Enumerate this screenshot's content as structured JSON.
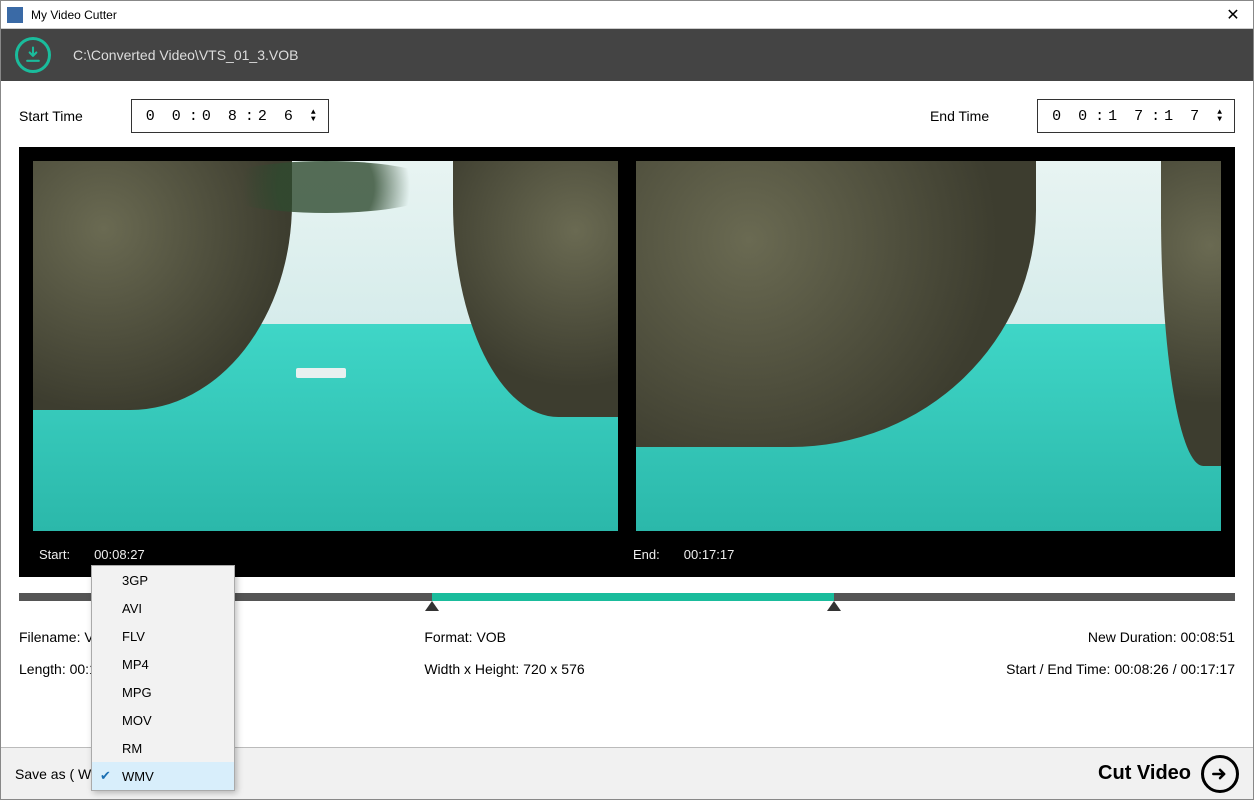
{
  "window": {
    "title": "My Video Cutter"
  },
  "header": {
    "file_path": "C:\\Converted Video\\VTS_01_3.VOB"
  },
  "time": {
    "start_label": "Start Time",
    "end_label": "End Time",
    "start_hh": "0 0",
    "start_mm": "0 8",
    "start_ss": "2 6",
    "end_hh": "0 0",
    "end_mm": "1 7",
    "end_ss": "1 7"
  },
  "preview": {
    "start_label": "Start:",
    "start_value": "00:08:27",
    "end_label": "End:",
    "end_value": "00:17:17"
  },
  "timeline": {
    "sel_start_pct": 34,
    "sel_end_pct": 67
  },
  "info": {
    "filename_label": "Filename:",
    "filename_value": "VTS_01_3.VOB",
    "format_label": "Format:",
    "format_value": "VOB",
    "newdur_label": "New Duration:",
    "newdur_value": "00:08:51",
    "length_label": "Length:",
    "length_value": "00:17:17",
    "dims_label": "Width x Height:",
    "dims_value": "720 x 576",
    "startend_label": "Start / End Time:",
    "startend_value": "00:08:26 / 00:17:17"
  },
  "footer": {
    "saveas_label": "Save as ( WMV ):",
    "cut_label": "Cut Video"
  },
  "dropdown": {
    "items": [
      {
        "label": "3GP",
        "selected": false
      },
      {
        "label": "AVI",
        "selected": false
      },
      {
        "label": "FLV",
        "selected": false
      },
      {
        "label": "MP4",
        "selected": false
      },
      {
        "label": "MPG",
        "selected": false
      },
      {
        "label": "MOV",
        "selected": false
      },
      {
        "label": "RM",
        "selected": false
      },
      {
        "label": "WMV",
        "selected": true
      }
    ]
  }
}
